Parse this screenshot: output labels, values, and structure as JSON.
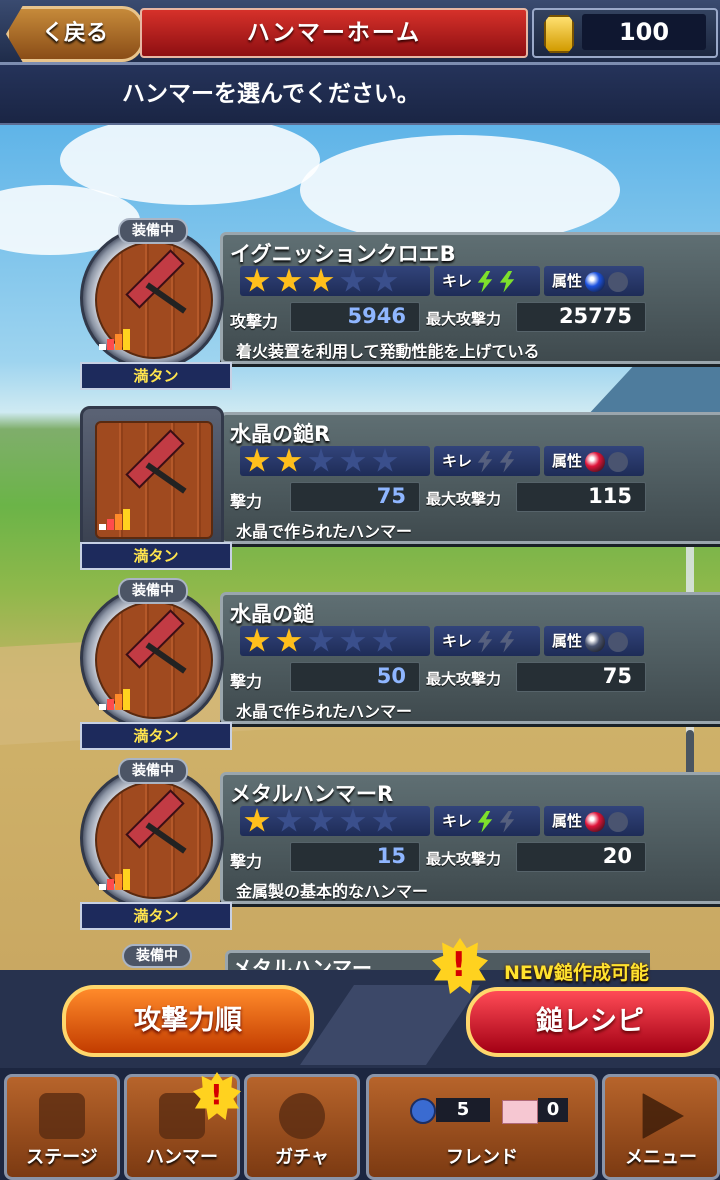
{
  "header": {
    "back_label": "く戻る",
    "title": "ハンマーホーム",
    "coins": "100"
  },
  "instruction": "ハンマーを選んでください。",
  "labels": {
    "kire": "キレ",
    "zokusei": "属性",
    "attack": "攻撃力",
    "attack_partial": "撃力",
    "max_attack": "最大攻撃力",
    "equipped": "装備中",
    "full": "満タン"
  },
  "hammers": [
    {
      "name": "イグニッションクロエB",
      "equipped": true,
      "stars": 3,
      "kire": 2,
      "attr_color": "#1c52e0",
      "attack": "5946",
      "max_attack": "25775",
      "desc": "着火装置を利用して発動性能を上げている"
    },
    {
      "name": "水晶の鎚R",
      "equipped": false,
      "stars": 2,
      "kire": 0,
      "attr_color": "#e0143a",
      "attack": "75",
      "max_attack": "115",
      "desc": "水晶で作られたハンマー"
    },
    {
      "name": "水晶の鎚",
      "equipped": true,
      "stars": 2,
      "kire": 0,
      "attr_color": "",
      "attack": "50",
      "max_attack": "75",
      "desc": "水晶で作られたハンマー"
    },
    {
      "name": "メタルハンマーR",
      "equipped": true,
      "stars": 1,
      "kire": 1,
      "attr_color": "#e0143a",
      "attack": "15",
      "max_attack": "20",
      "desc": "金属製の基本的なハンマー"
    }
  ],
  "partial_item": {
    "name": "メタルハンマー"
  },
  "buttons": {
    "sort": "攻撃力順",
    "recipe": "鎚レシピ",
    "new_label": "NEW鎚作成可能"
  },
  "tabs": [
    "ステージ",
    "ハンマー",
    "ガチャ",
    "フレンド",
    "メニュー"
  ],
  "friend": {
    "bombs": "5",
    "mail": "0"
  },
  "colors": {
    "star_on": "#ffbf1c",
    "bolt_on": "#7ee02c",
    "title_red": "#c9232a"
  }
}
